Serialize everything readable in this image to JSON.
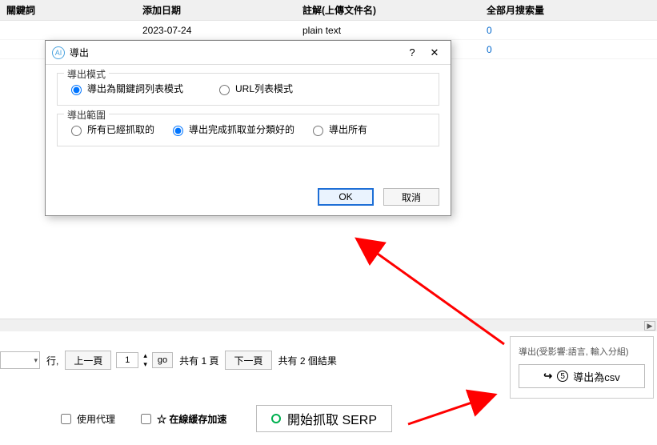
{
  "table": {
    "headers": [
      "關鍵詞",
      "添加日期",
      "註解(上傳文件名)",
      "全部月搜索量"
    ],
    "rows": [
      {
        "c0": "",
        "c1": "2023-07-24",
        "c2": "plain text",
        "c3": "0"
      },
      {
        "c0": "",
        "c1": "",
        "c2": "",
        "c3": "0"
      }
    ]
  },
  "pager": {
    "row_label": "行,",
    "prev": "上一頁",
    "page_value": "1",
    "go": "go",
    "total_pages_text": "共有 1 頁",
    "next": "下一頁",
    "total_results_text": "共有 2 個結果"
  },
  "checks": {
    "proxy": "使用代理",
    "cache": "☆ 在線緩存加速"
  },
  "start_button": "開始抓取 SERP",
  "export_pane": {
    "hint": "導出(受影響:語言, 輸入分組)",
    "step_num": "5",
    "label": "導出為csv"
  },
  "dialog": {
    "title": "導出",
    "group1_legend": "導出模式",
    "g1_opt1": "導出為關鍵詞列表模式",
    "g1_opt2": "URL列表模式",
    "group2_legend": "導出範圍",
    "g2_opt1": "所有已經抓取的",
    "g2_opt2": "導出完成抓取並分類好的",
    "g2_opt3": "導出所有",
    "ok": "OK",
    "cancel": "取消"
  }
}
